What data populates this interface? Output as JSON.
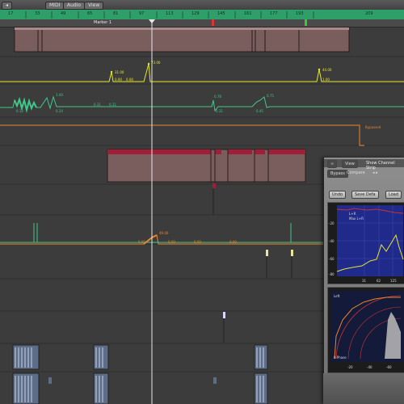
{
  "toolbar": {
    "back_label": "◂",
    "midi_label": "MIDI",
    "audio_label": "Audio",
    "view_label": "View"
  },
  "ruler": {
    "bars": [
      "17",
      "33",
      "49",
      "65",
      "81",
      "97",
      "113",
      "129",
      "145",
      "161",
      "177",
      "193",
      "209"
    ]
  },
  "marker": {
    "label": "Marker 1"
  },
  "automation_values": {
    "yellow": [
      "31.00",
      "0.00",
      "0.00",
      "73.00",
      "44.00",
      "1.00"
    ],
    "green": [
      "0.12",
      "1.00",
      "0.24",
      "0.31",
      "0.31",
      "0.78",
      "0.31",
      "0.75",
      "0.45"
    ],
    "orange_bypass": "Bypassed",
    "orange2": [
      "0.00",
      "49.00",
      "0.00",
      "0.00",
      "0.00"
    ]
  },
  "plugin": {
    "link_label": "∞",
    "view_label": "View",
    "show_channel_strip_label": "Show Channel Strip",
    "bypass_label": "Bypass",
    "compare_label": "Compare",
    "undo_label": "Undo",
    "save_default_label": "Save Defa",
    "load_label": "Load",
    "eq_legend_l": "L+R",
    "eq_legend_max": "Max L+R",
    "eq_scale": [
      "-20",
      "-40",
      "-60",
      "-80"
    ],
    "eq_freq": [
      "31",
      "62",
      "125"
    ],
    "analyzer_title": "Left",
    "analyzer_phase": "0 Phase",
    "analyzer_scale": [
      "-20",
      "-40",
      "-60"
    ]
  },
  "colors": {
    "yellow": "#e6e62a",
    "green": "#3fc98a",
    "orange": "#e8872c",
    "region_red": "#a01e38",
    "ruler": "#2f9f6a"
  }
}
